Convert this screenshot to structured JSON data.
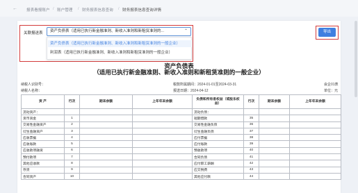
{
  "breadcrumb": {
    "items": [
      "报表看报账户",
      "账户管理",
      "财务报表信息查询",
      "财务报表信息查询详情"
    ]
  },
  "selector": {
    "label": "关联报送表",
    "value": "资产负债表（适用已执行新金融准则、新收入准则和新租赁准则的...",
    "options": [
      "资产负债表（适用已执行新金融准则、新收入准则和新租赁准则的一般企业）",
      "利润表（适用已执行新金融准则、新收入准则和新租赁准则的一般企业）"
    ]
  },
  "export_label": "导出",
  "report": {
    "title": "资产负债表",
    "subtitle": "（适用已执行新金融准则、新收入准则和新租赁准则的一般企业）",
    "taxpayer_id_label": "纳税人识别号：",
    "taxpayer_name_label": "纳税人名称：",
    "period_label": "税款所属期间：2024-01-01至2024-03-31",
    "filing_date_label": "报送日期：2024-04-12",
    "form_code": "会企01表",
    "unit": "单位：元",
    "headers": [
      "资  产",
      "行次",
      "期末余额",
      "上年年末余额",
      "负债和所有者权益（或股东权益）",
      "行次",
      "期末余额",
      "上年年末余额"
    ],
    "rows": [
      [
        "流动资产：",
        "",
        "",
        "",
        "流动负债：",
        "",
        "",
        ""
      ],
      [
        "货币资金",
        "1",
        "",
        "",
        "短期借款",
        "35",
        "",
        ""
      ],
      [
        "交易性金融资产",
        "2",
        "",
        "",
        "交易性金融负债",
        "36",
        "",
        ""
      ],
      [
        "衍生金融资产",
        "3",
        "",
        "",
        "衍生金融负债",
        "37",
        "",
        ""
      ],
      [
        "应收票据",
        "4",
        "",
        "",
        "应付票据",
        "38",
        "",
        ""
      ],
      [
        "应收账款",
        "5",
        "",
        "",
        "应付账款",
        "39",
        "",
        ""
      ],
      [
        "应收款项融资",
        "6",
        "",
        "",
        "预收款项",
        "40",
        "",
        ""
      ],
      [
        "预付款项",
        "7",
        "",
        "",
        "合同负债",
        "41",
        "",
        ""
      ],
      [
        "其他应收款",
        "8",
        "",
        "",
        "应付职工薪酬",
        "42",
        "",
        ""
      ],
      [
        "存货",
        "9",
        "",
        "",
        "应交税费",
        "43",
        "",
        ""
      ],
      [
        "合同资产",
        "10",
        "",
        "",
        "其他应付款",
        "44",
        "",
        ""
      ]
    ]
  }
}
